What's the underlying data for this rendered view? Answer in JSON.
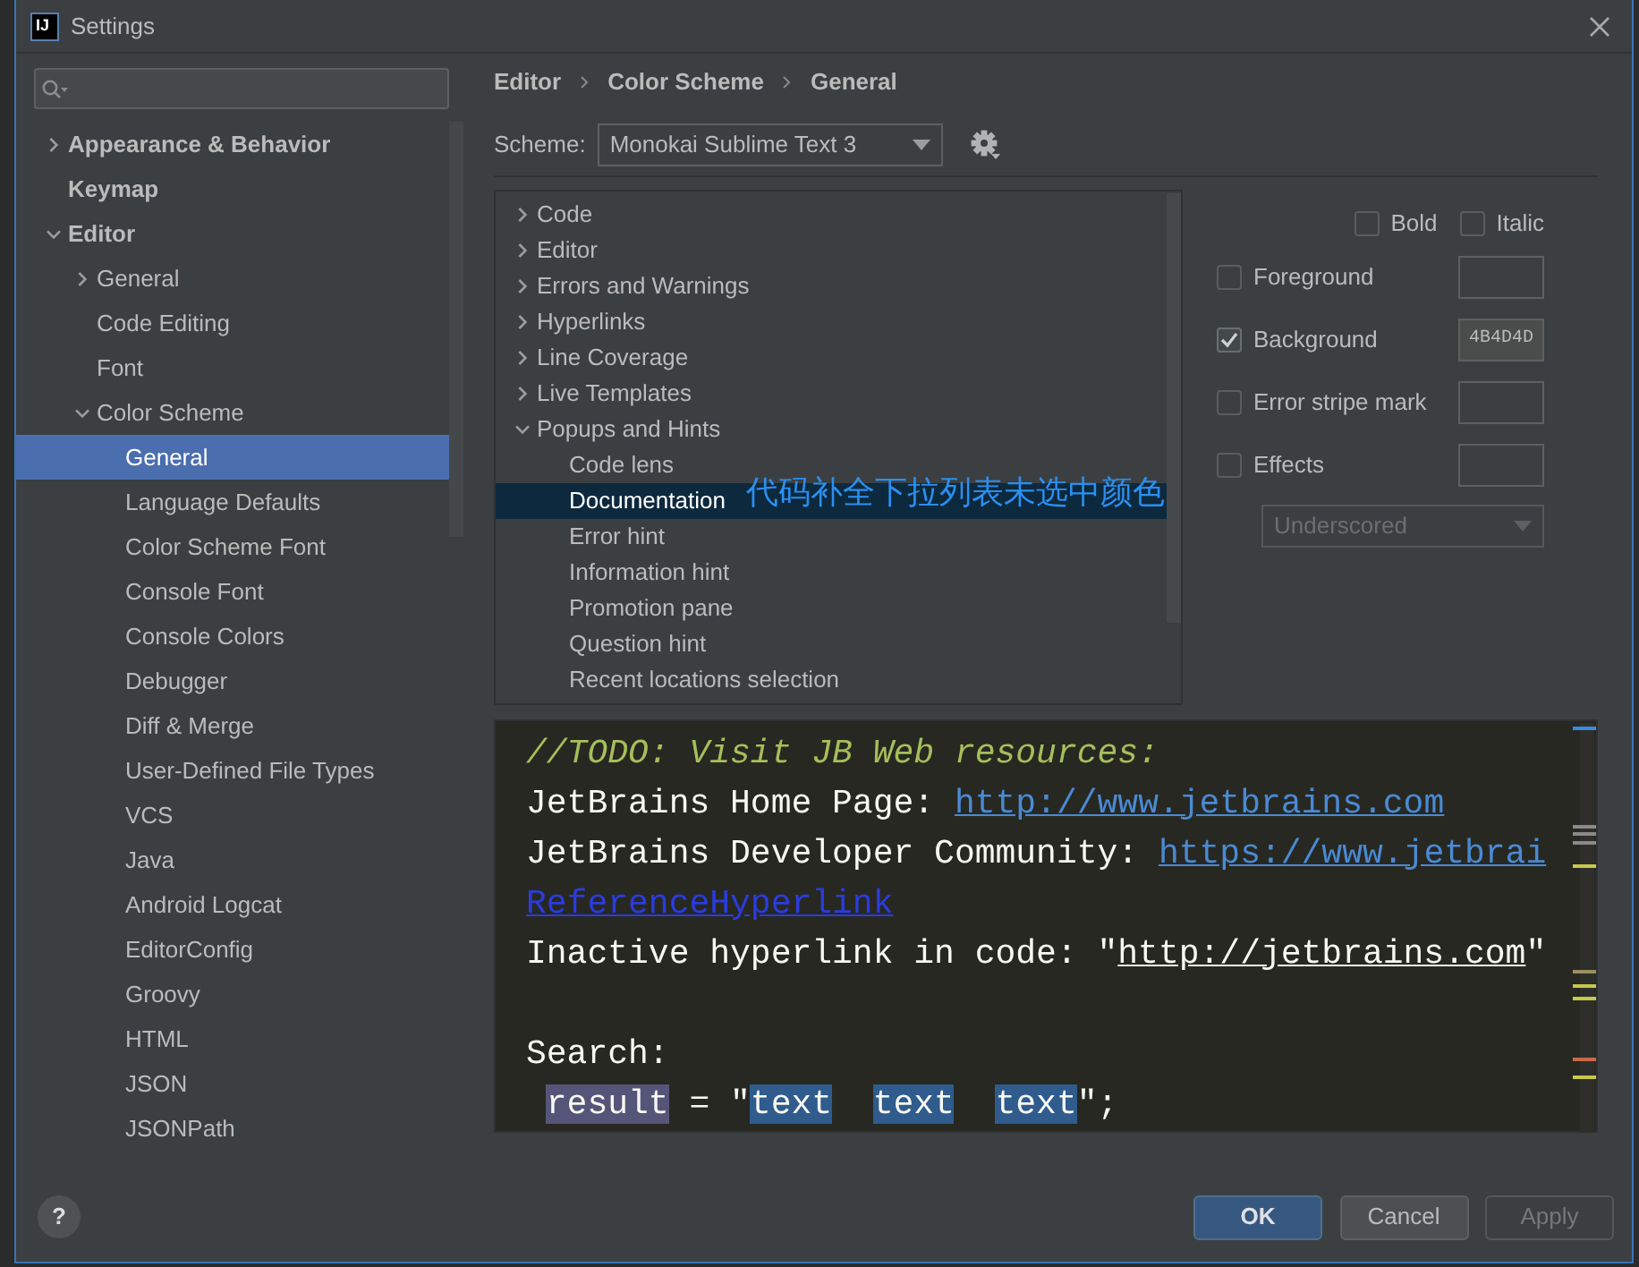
{
  "window": {
    "logo": "IJ",
    "title": "Settings"
  },
  "sidebar": {
    "items": [
      {
        "label": "Appearance & Behavior",
        "expanded": false,
        "selected": false
      },
      {
        "label": "Keymap",
        "selected": false
      },
      {
        "label": "Editor",
        "expanded": true,
        "selected": false,
        "children": [
          {
            "label": "General",
            "expanded": false,
            "selected": false
          },
          {
            "label": "Code Editing",
            "selected": false
          },
          {
            "label": "Font",
            "selected": false
          },
          {
            "label": "Color Scheme",
            "expanded": true,
            "selected": false,
            "children": [
              {
                "label": "General",
                "selected": true
              },
              {
                "label": "Language Defaults",
                "selected": false
              },
              {
                "label": "Color Scheme Font",
                "selected": false
              },
              {
                "label": "Console Font",
                "selected": false
              },
              {
                "label": "Console Colors",
                "selected": false
              },
              {
                "label": "Debugger",
                "selected": false
              },
              {
                "label": "Diff & Merge",
                "selected": false
              },
              {
                "label": "User-Defined File Types",
                "selected": false
              },
              {
                "label": "VCS",
                "selected": false
              },
              {
                "label": "Java",
                "selected": false
              },
              {
                "label": "Android Logcat",
                "selected": false
              },
              {
                "label": "EditorConfig",
                "selected": false
              },
              {
                "label": "Groovy",
                "selected": false
              },
              {
                "label": "HTML",
                "selected": false
              },
              {
                "label": "JSON",
                "selected": false
              },
              {
                "label": "JSONPath",
                "selected": false
              }
            ]
          }
        ]
      }
    ]
  },
  "breadcrumb": [
    "Editor",
    "Color Scheme",
    "General"
  ],
  "scheme": {
    "label": "Scheme:",
    "value": "Monokai Sublime Text 3"
  },
  "elements_tree": {
    "items": [
      {
        "label": "Code",
        "expanded": false,
        "selected": false
      },
      {
        "label": "Editor",
        "expanded": false,
        "selected": false
      },
      {
        "label": "Errors and Warnings",
        "expanded": false,
        "selected": false
      },
      {
        "label": "Hyperlinks",
        "expanded": false,
        "selected": false
      },
      {
        "label": "Line Coverage",
        "expanded": false,
        "selected": false
      },
      {
        "label": "Live Templates",
        "expanded": false,
        "selected": false
      },
      {
        "label": "Popups and Hints",
        "expanded": true,
        "selected": false,
        "children": [
          {
            "label": "Code lens",
            "selected": false
          },
          {
            "label": "Documentation",
            "selected": true
          },
          {
            "label": "Error hint",
            "selected": false
          },
          {
            "label": "Information hint",
            "selected": false
          },
          {
            "label": "Promotion pane",
            "selected": false
          },
          {
            "label": "Question hint",
            "selected": false
          },
          {
            "label": "Recent locations selection",
            "selected": false
          }
        ]
      }
    ]
  },
  "annotation": {
    "text": "代码补全下拉列表未选中颜色"
  },
  "attributes": {
    "font_styles": [
      {
        "label": "Bold",
        "checked": false
      },
      {
        "label": "Italic",
        "checked": false
      }
    ],
    "colors": [
      {
        "label": "Foreground",
        "checked": false
      },
      {
        "label": "Background",
        "checked": true,
        "value": "4B4D4D"
      },
      {
        "label": "Error stripe mark",
        "checked": false
      },
      {
        "label": "Effects",
        "checked": false
      }
    ],
    "effect_type": {
      "value": "Underscored",
      "disabled": true
    }
  },
  "preview": {
    "lines": [
      {
        "kind": "code",
        "segments": [
          {
            "kind": "comment",
            "text": "//TODO: Visit JB Web resources:"
          }
        ]
      },
      {
        "kind": "code",
        "segments": [
          {
            "kind": "plain",
            "text": "JetBrains Home Page: "
          },
          {
            "kind": "link",
            "text": "http://www.jetbrains.com"
          }
        ]
      },
      {
        "kind": "code",
        "segments": [
          {
            "kind": "plain",
            "text": "JetBrains Developer Community: "
          },
          {
            "kind": "link",
            "text": "https://www.jetbrai"
          }
        ]
      },
      {
        "kind": "code",
        "segments": [
          {
            "kind": "reference",
            "text": "ReferenceHyperlink"
          }
        ]
      },
      {
        "kind": "code",
        "segments": [
          {
            "kind": "plain",
            "text": "Inactive hyperlink in code: \""
          },
          {
            "kind": "inactive_link",
            "text": "http://jetbrains.com"
          },
          {
            "kind": "plain",
            "text": "\""
          }
        ]
      },
      {
        "kind": "blank"
      },
      {
        "kind": "code",
        "segments": [
          {
            "kind": "plain",
            "text": "Search:"
          }
        ]
      },
      {
        "kind": "code",
        "segments": [
          {
            "kind": "indent"
          },
          {
            "kind": "search_var",
            "text": "result"
          },
          {
            "kind": "plain",
            "text": " = \""
          },
          {
            "kind": "match",
            "text": "text"
          },
          {
            "kind": "gap"
          },
          {
            "kind": "match",
            "text": "text"
          },
          {
            "kind": "gap"
          },
          {
            "kind": "match",
            "text": "text"
          },
          {
            "kind": "plain",
            "text": "\";"
          }
        ]
      }
    ]
  },
  "help": {
    "label": "?"
  },
  "buttons": [
    {
      "label": "OK",
      "kind": "default",
      "disabled": false
    },
    {
      "label": "Cancel",
      "kind": "normal",
      "disabled": false
    },
    {
      "label": "Apply",
      "kind": "normal",
      "disabled": true
    }
  ]
}
